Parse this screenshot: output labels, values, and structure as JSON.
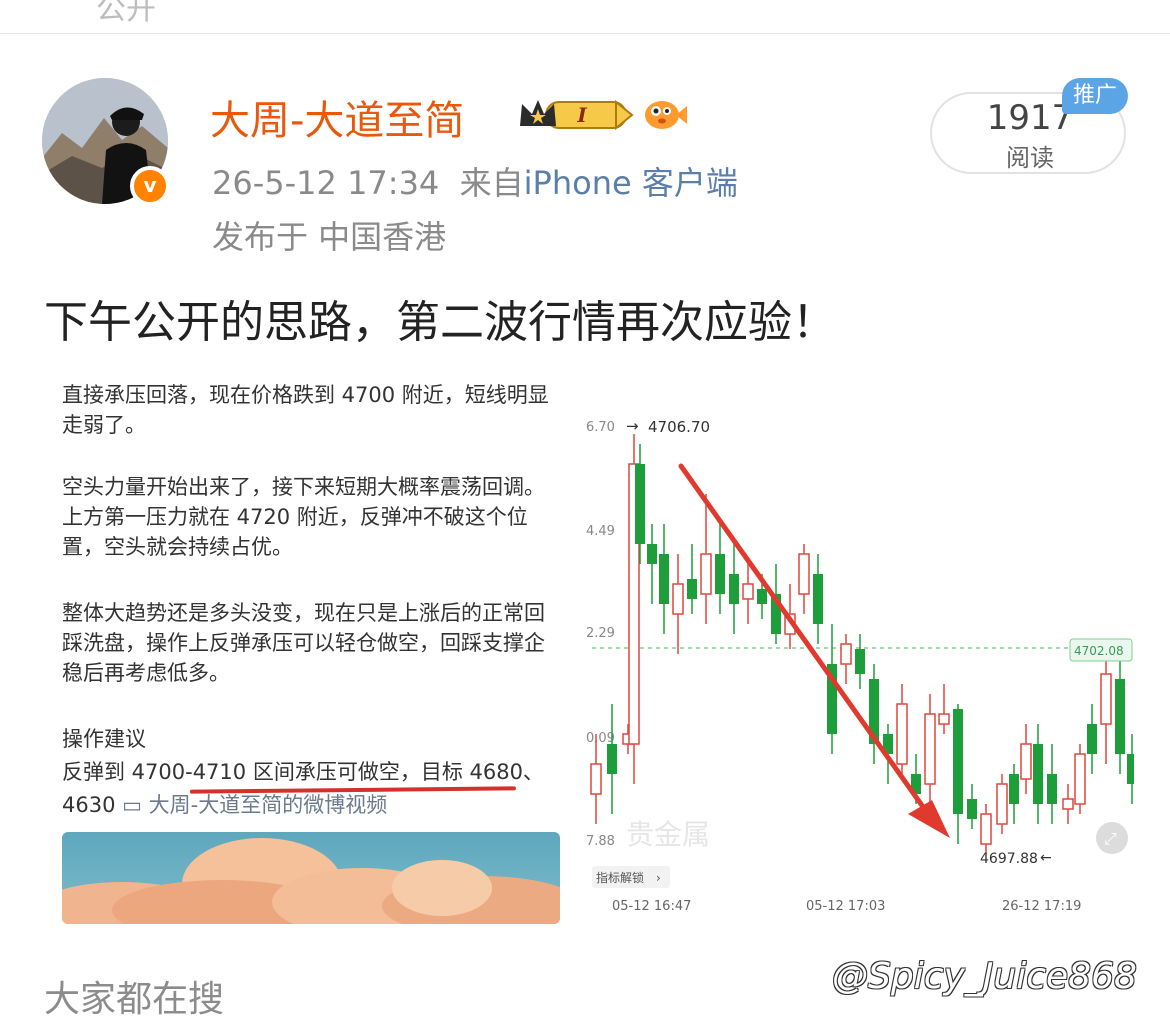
{
  "topbar": {
    "back_fragment": "公开"
  },
  "author": {
    "name": "大周-大道至简",
    "vip_level": "I",
    "verified_mark": "v",
    "timestamp": "26-5-12 17:34",
    "source_prefix": "来自",
    "source_device": "iPhone 客户端",
    "location": "发布于 中国香港"
  },
  "reads": {
    "count": "1917",
    "label": "阅读",
    "promo_tag": "推广"
  },
  "post": {
    "text": "下午公开的思路，第二波行情再次应验！"
  },
  "embedded_note": {
    "para1": "直接承压回落，现在价格跌到 4700 附近，短线明显走弱了。",
    "para2": "空头力量开始出来了，接下来短期大概率震荡回调。上方第一压力就在 4720 附近，反弹冲不破这个位置，空头就会持续占优。",
    "para3": "整体大趋势还是多头没变，现在只是上涨后的正常回踩洗盘，操作上反弹承压可以轻仓做空，回踩支撑企稳后再考虑低多。",
    "op_title": "操作建议",
    "op_line": "反弹到 4700-4710 区间承压可做空，目标 4680、",
    "op_line2_value": "4630",
    "op_line2_video": "大周-大道至简的微博视频"
  },
  "embedded_chart": {
    "y_labels": [
      "6.70",
      "4.49",
      "2.29",
      "0.09",
      "7.88"
    ],
    "high_label": "4706.70",
    "low_label": "4697.88",
    "current_price_tag": "4702.08",
    "x_labels": [
      "05-12 16:47",
      "05-12 17:03",
      "26-12 17:19"
    ],
    "indicator_button": "指标解锁",
    "watermark": "贵金属"
  },
  "footer": {
    "search_label": "大家都在搜",
    "watermark": "@Spicy_Juice868"
  },
  "colors": {
    "brand_orange": "#e8590c",
    "up_red": "#e0463e",
    "down_green": "#1e9e3a",
    "promo_blue": "#5ba5e6"
  }
}
